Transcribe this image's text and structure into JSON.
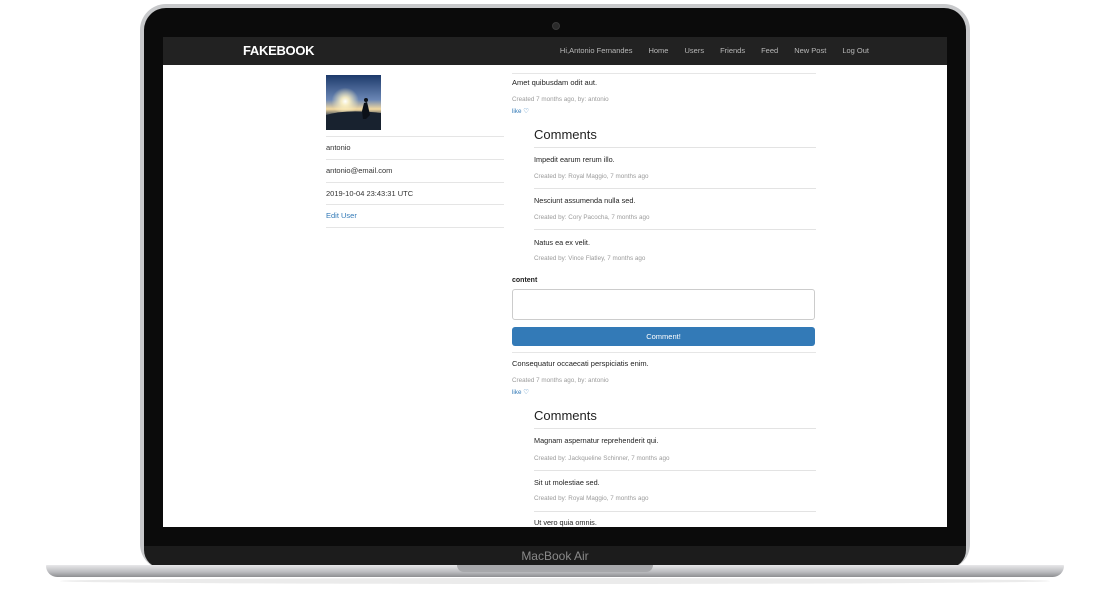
{
  "device": {
    "label": "MacBook Air"
  },
  "navbar": {
    "brand": "FAKEBOOK",
    "links": [
      "Hi,Antonio Fernandes",
      "Home",
      "Users",
      "Friends",
      "Feed",
      "New Post",
      "Log Out"
    ]
  },
  "profile": {
    "username": "antonio",
    "email": "antonio@email.com",
    "created_at": "2019-10-04 23:43:31 UTC",
    "edit_link": "Edit User"
  },
  "posts": [
    {
      "content": "Amet quibusdam odit aut.",
      "meta": "Created 7 months ago, by: antonio",
      "like": "like ♡",
      "comments_title": "Comments",
      "comments": [
        {
          "text": "Impedit earum rerum illo.",
          "meta": "Created by: Royal Maggio, 7 months ago"
        },
        {
          "text": "Nesciunt assumenda nulla sed.",
          "meta": "Created by: Cory Pacocha, 7 months ago"
        },
        {
          "text": "Natus ea ex velit.",
          "meta": "Created by: Vince Flatley, 7 months ago"
        }
      ],
      "form": {
        "label": "content",
        "textarea_value": "",
        "submit_label": "Comment!"
      }
    },
    {
      "content": "Consequatur occaecati perspiciatis enim.",
      "meta": "Created 7 months ago, by: antonio",
      "like": "like ♡",
      "comments_title": "Comments",
      "comments": [
        {
          "text": "Magnam aspernatur reprehenderit qui.",
          "meta": "Created by: Jackqueline Schinner, 7 months ago"
        },
        {
          "text": "Sit ut molestiae sed.",
          "meta": "Created by: Royal Maggio, 7 months ago"
        },
        {
          "text": "Ut vero quia omnis."
        }
      ]
    }
  ],
  "colors": {
    "navbar_bg": "#222222",
    "link": "#337ab7",
    "button": "#337ab7"
  }
}
